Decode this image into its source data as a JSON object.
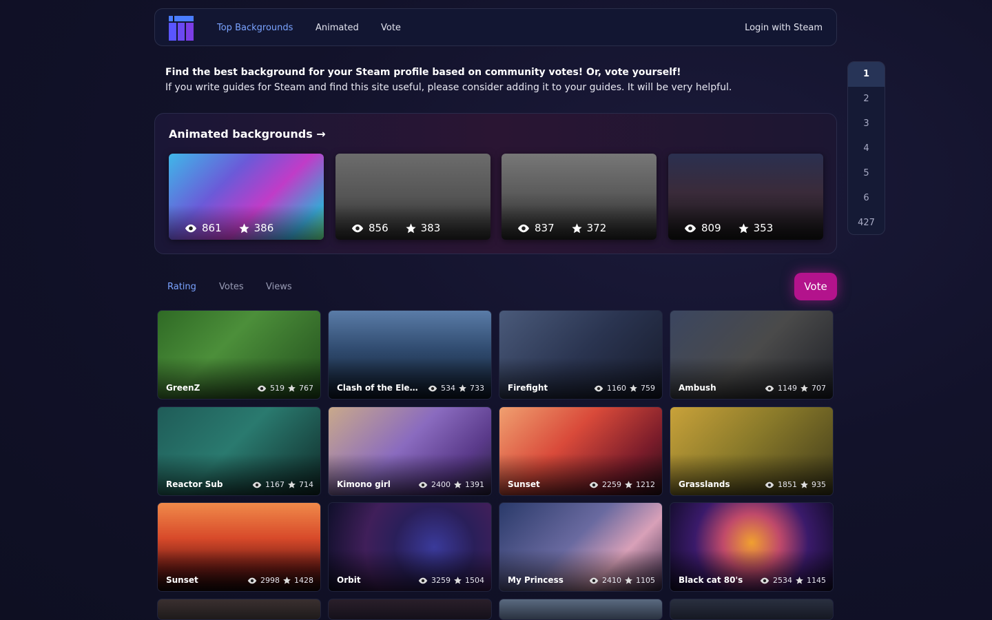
{
  "nav": {
    "links": [
      "Top Backgrounds",
      "Animated",
      "Vote"
    ],
    "login": "Login with Steam"
  },
  "intro": {
    "headline": "Find the best background for your Steam profile based on community votes! Or, vote yourself!",
    "subtext": "If you write guides for Steam and find this site useful, please consider adding it to your guides. It will be very helpful."
  },
  "animated": {
    "title": "Animated backgrounds →",
    "cards": [
      {
        "views": "861",
        "stars": "386"
      },
      {
        "views": "856",
        "stars": "383"
      },
      {
        "views": "837",
        "stars": "372"
      },
      {
        "views": "809",
        "stars": "353"
      }
    ]
  },
  "pagination": [
    "1",
    "2",
    "3",
    "4",
    "5",
    "6",
    "427"
  ],
  "sort_tabs": [
    "Rating",
    "Votes",
    "Views"
  ],
  "vote_button": "Vote",
  "backgrounds": [
    {
      "name": "GreenZ",
      "views": "519",
      "stars": "767"
    },
    {
      "name": "Clash of the Elements",
      "views": "534",
      "stars": "733"
    },
    {
      "name": "Firefight",
      "views": "1160",
      "stars": "759"
    },
    {
      "name": "Ambush",
      "views": "1149",
      "stars": "707"
    },
    {
      "name": "Reactor Sub",
      "views": "1167",
      "stars": "714"
    },
    {
      "name": "Kimono girl",
      "views": "2400",
      "stars": "1391"
    },
    {
      "name": "Sunset",
      "views": "2259",
      "stars": "1212"
    },
    {
      "name": "Grasslands",
      "views": "1851",
      "stars": "935"
    },
    {
      "name": "Sunset",
      "views": "2998",
      "stars": "1428"
    },
    {
      "name": "Orbit",
      "views": "3259",
      "stars": "1504"
    },
    {
      "name": "My Princess",
      "views": "2410",
      "stars": "1105"
    },
    {
      "name": "Black cat 80's",
      "views": "2534",
      "stars": "1145"
    }
  ],
  "colors": {
    "accent": "#7aa3ff",
    "vote": "#b3138c",
    "background": "#12122a"
  }
}
